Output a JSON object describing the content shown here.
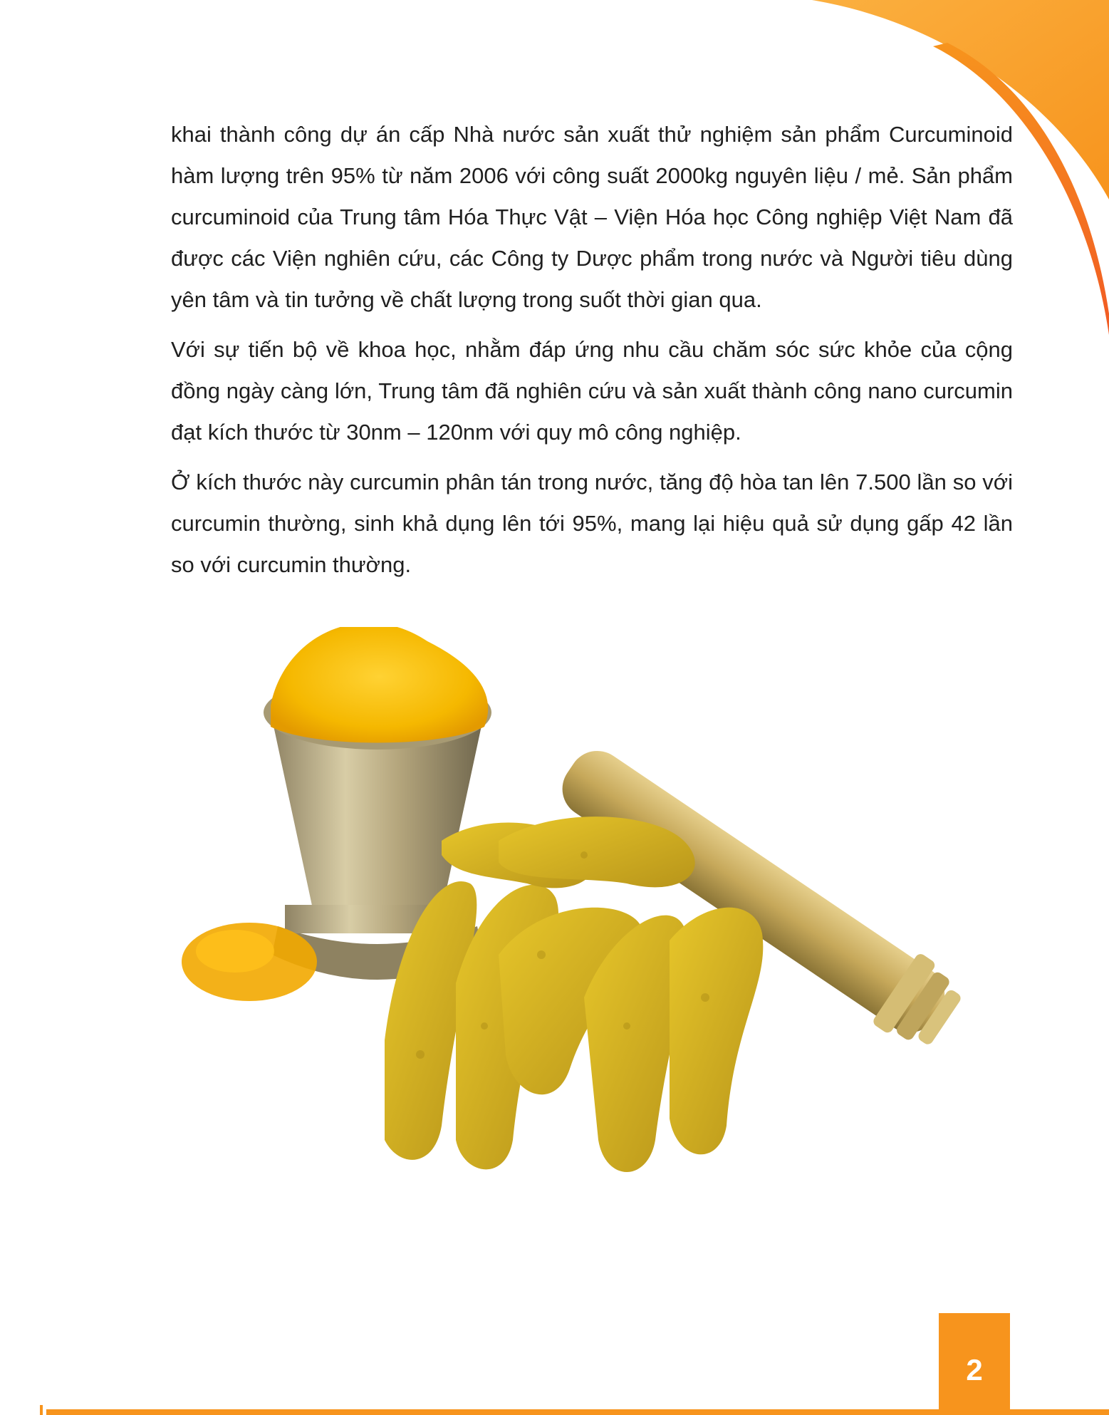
{
  "paragraphs": [
    "khai thành công dự án cấp Nhà nước sản xuất thử nghiệm sản phẩm Curcuminoid hàm lượng trên 95% từ năm 2006 với công suất 2000kg nguyên liệu / mẻ. Sản phẩm curcuminoid của Trung tâm Hóa Thực Vật – Viện Hóa học Công nghiệp Việt Nam đã được các Viện nghiên cứu, các Công ty Dược phẩm trong nước và Người tiêu dùng yên tâm và tin tưởng về chất lượng trong suốt thời gian qua.",
    "Với sự tiến bộ về khoa học, nhằm đáp ứng nhu cầu chăm sóc sức khỏe của cộng đồng ngày càng lớn, Trung tâm đã nghiên cứu và sản xuất thành công nano curcumin đạt kích thước từ 30nm – 120nm với quy mô công nghiệp.",
    "Ở kích thước này curcumin phân tán trong nước, tăng độ hòa tan lên 7.500 lần so với curcumin thường, sinh khả dụng lên tới 95%, mang lại hiệu quả sử dụng gấp 42 lần so với curcumin thường."
  ],
  "page_number": "2",
  "colors": {
    "accent": "#f7941d",
    "accent_light": "#fbb040",
    "accent_red": "#f15a24",
    "turmeric": "#f5b800",
    "root": "#d4b21a",
    "brass": "#c9b886"
  }
}
